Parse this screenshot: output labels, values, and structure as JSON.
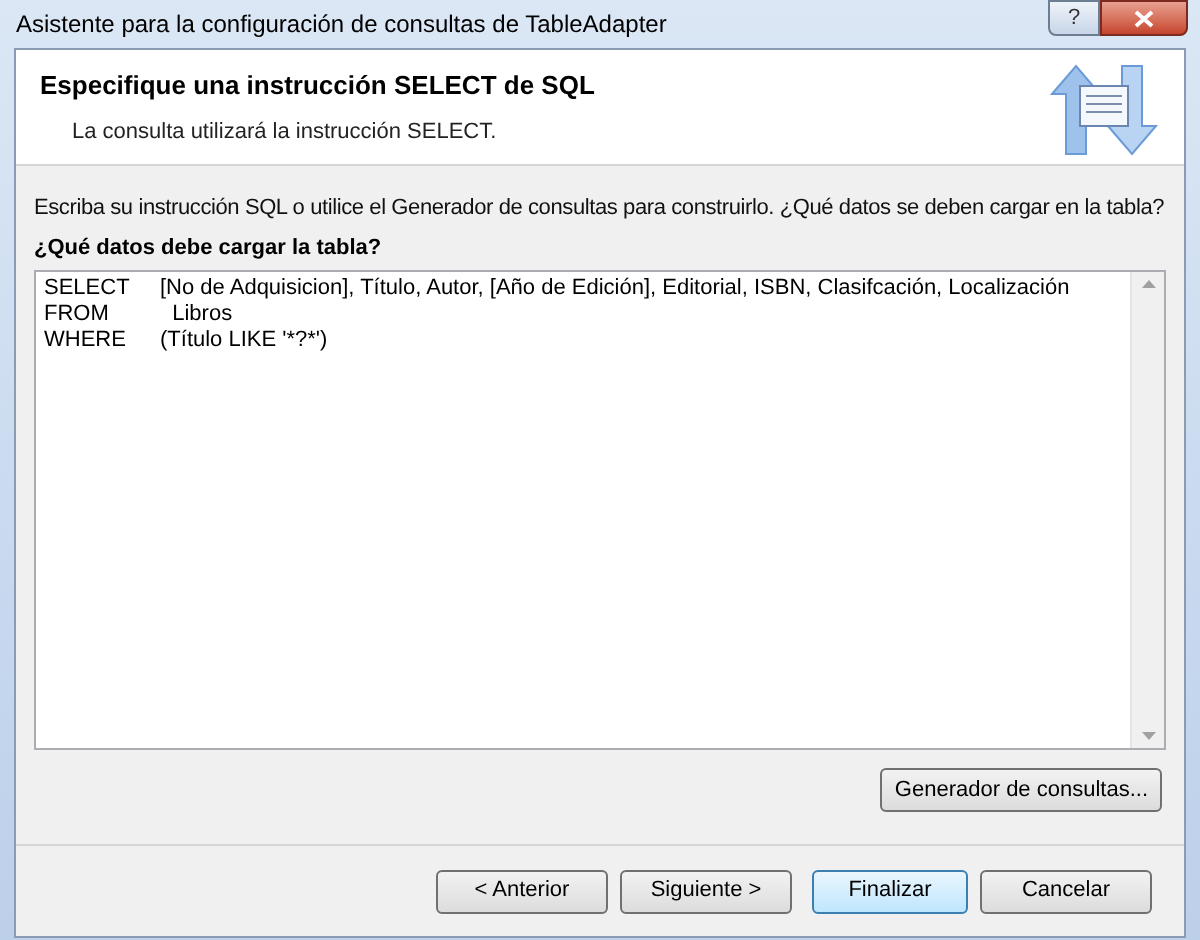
{
  "window": {
    "title": "Asistente para la configuración de consultas de TableAdapter",
    "help_button": "?"
  },
  "header": {
    "title": "Especifique una instrucción SELECT de SQL",
    "subtitle": "La consulta utilizará la instrucción SELECT."
  },
  "instructions": "Escriba su instrucción SQL o utilice el Generador de consultas para construirlo. ¿Qué datos se deben cargar en la tabla?",
  "query_label": "¿Qué datos debe cargar la tabla?",
  "query_lines": [
    {
      "keyword": "SELECT",
      "text": "[No de Adquisicion], Título, Autor, [Año de Edición], Editorial, ISBN, Clasifcación, Localización"
    },
    {
      "keyword": "FROM",
      "text": "  Libros"
    },
    {
      "keyword": "WHERE",
      "text": "(Título LIKE '*?*')"
    }
  ],
  "query_builder_button": "Generador de consultas...",
  "buttons": [
    {
      "label": "< Anterior",
      "default": false
    },
    {
      "label": "Siguiente >",
      "default": false
    },
    {
      "label": "Finalizar",
      "default": true
    },
    {
      "label": "Cancelar",
      "default": false
    }
  ]
}
